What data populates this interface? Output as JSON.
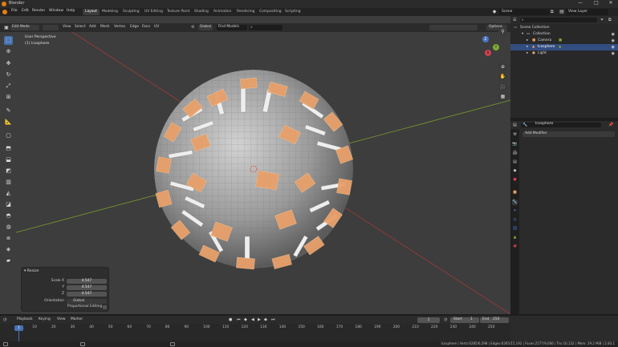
{
  "app": {
    "title": "Blender"
  },
  "window_controls": {
    "minimize": "—",
    "maximize": "□",
    "close": "✕"
  },
  "menus": [
    "File",
    "Edit",
    "Render",
    "Window",
    "Help"
  ],
  "workspaces": [
    {
      "label": "Layout",
      "active": true
    },
    {
      "label": "Modeling"
    },
    {
      "label": "Sculpting"
    },
    {
      "label": "UV Editing"
    },
    {
      "label": "Texture Paint"
    },
    {
      "label": "Shading"
    },
    {
      "label": "Animation"
    },
    {
      "label": "Rendering"
    },
    {
      "label": "Compositing"
    },
    {
      "label": "Scripting"
    }
  ],
  "scene": {
    "name": "Scene",
    "view_layer": "View Layer"
  },
  "viewport_header": {
    "mode": "Edit Mode",
    "menus": [
      "View",
      "Select",
      "Add",
      "Mesh",
      "Vertex",
      "Edge",
      "Face",
      "UV"
    ],
    "orientation": "Global",
    "find_models": "Find Models",
    "options": "Options"
  },
  "viewport_overlay": {
    "view_name": "User Perspective",
    "object_name": "(1) Icosphere"
  },
  "gizmo": {
    "x": "X",
    "y": "Y",
    "z": "Z"
  },
  "redo_panel": {
    "title": "Resize",
    "rows": [
      {
        "label": "Scale X",
        "value": "4.547"
      },
      {
        "label": "Y",
        "value": "4.547"
      },
      {
        "label": "Z",
        "value": "4.547"
      }
    ],
    "orientation_label": "Orientation",
    "orientation_value": "Global",
    "proportional_label": "Proportional Editing"
  },
  "outliner": {
    "items": [
      {
        "label": "Scene Collection",
        "indent": 0,
        "selected": false
      },
      {
        "label": "Collection",
        "indent": 1,
        "selected": false
      },
      {
        "label": "Camera",
        "indent": 2,
        "selected": false
      },
      {
        "label": "Icosphere",
        "indent": 2,
        "selected": true
      },
      {
        "label": "Light",
        "indent": 2,
        "selected": false
      }
    ]
  },
  "properties": {
    "object_name": "Icosphere",
    "add_modifier": "Add Modifier"
  },
  "timeline": {
    "menus": [
      "Playback",
      "Keying",
      "View",
      "Marker"
    ],
    "current_frame": "1",
    "start_label": "Start",
    "start_value": "1",
    "end_label": "End",
    "end_value": "250",
    "frame_field": "1",
    "ticks": [
      "1",
      "10",
      "20",
      "30",
      "40",
      "50",
      "60",
      "70",
      "80",
      "90",
      "100",
      "110",
      "120",
      "130",
      "140",
      "150",
      "160",
      "170",
      "180",
      "190",
      "200",
      "210",
      "220",
      "230",
      "240",
      "250"
    ]
  },
  "status": {
    "text": "Icosphere | Verts:6285/6,598 | Edges:6265/15,192 | Faces:2577/9,006 | Tris:10,132 | Mem: 29.2 MiB | 2.83.1"
  },
  "colors": {
    "accent": "#4772b3",
    "selection_orange": "#e8a06a",
    "x_axis": "#9b3b3b",
    "y_axis": "#7a9b2e"
  }
}
